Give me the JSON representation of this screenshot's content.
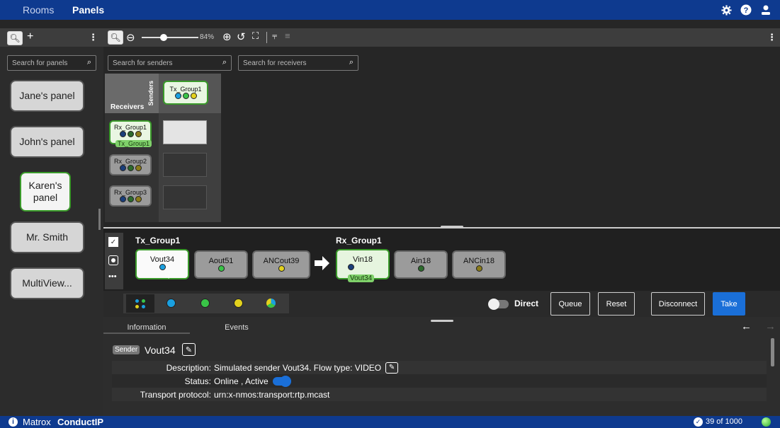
{
  "topbar": {
    "tabs": [
      "Rooms",
      "Panels"
    ],
    "icons": [
      "gear-icon",
      "help-icon",
      "user-icon"
    ]
  },
  "left": {
    "search_placeholder": "Search for panels",
    "panels": [
      "Jane's panel",
      "John's panel",
      "Karen's panel",
      "Mr. Smith",
      "MultiView..."
    ],
    "selected": "Karen's panel"
  },
  "main_toolbar": {
    "zoom": "84%"
  },
  "matrix": {
    "sender_search": "Search for senders",
    "receiver_search": "Search for receivers",
    "receivers_label": "Receivers",
    "senders_label": "Senders",
    "sender": "Tx_Group1",
    "receivers": [
      "Rx_Group1",
      "Rx_Group2",
      "Rx_Group3"
    ],
    "rx1_tag": "Tx_Group1"
  },
  "routing": {
    "tx_title": "Tx_Group1",
    "rx_title": "Rx_Group1",
    "tx_items": [
      "Vout34",
      "Aout51",
      "ANCout39"
    ],
    "rx_items": [
      "Vin18",
      "Ain18",
      "ANCin18"
    ],
    "vin_tag": "Vout34"
  },
  "actions": {
    "direct": "Direct",
    "queue": "Queue",
    "reset": "Reset",
    "disconnect": "Disconnect",
    "take": "Take"
  },
  "info": {
    "tabs": [
      "Information",
      "Events"
    ],
    "badge": "Sender",
    "name": "Vout34",
    "description_label": "Description:",
    "description": "Simulated sender Vout34. Flow type: VIDEO",
    "status_label": "Status:",
    "status": "Online , Active",
    "transport_label": "Transport protocol:",
    "transport": "urn:x-nmos:transport:rtp.mcast"
  },
  "status": {
    "brand_a": "Matrox",
    "brand_b": "ConductIP",
    "count": "39 of 1000"
  },
  "colors": {
    "topbar": "#0e3a8f",
    "accent_green": "#3a9a2a",
    "take_blue": "#1a6fd8"
  }
}
